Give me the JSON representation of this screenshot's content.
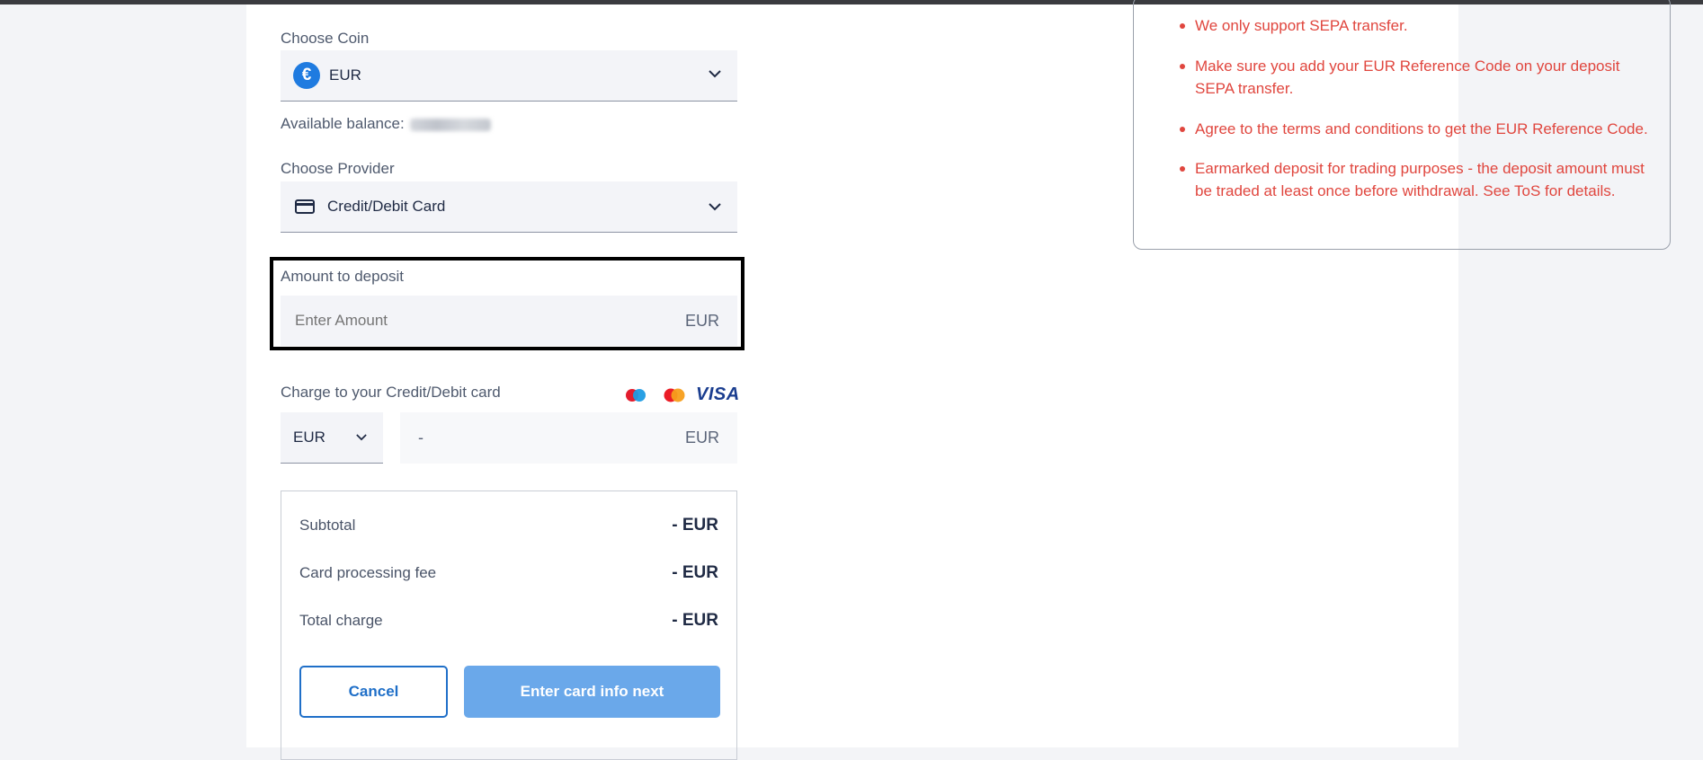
{
  "coin": {
    "label": "Choose Coin",
    "selected": "EUR",
    "icon_glyph": "€",
    "icon": "euro-coin-icon",
    "available_label": "Available balance:"
  },
  "provider": {
    "label": "Choose Provider",
    "selected": "Credit/Debit Card",
    "icon": "credit-card-icon"
  },
  "deposit": {
    "label": "Amount to deposit",
    "placeholder": "Enter Amount",
    "currency": "EUR"
  },
  "charge": {
    "label": "Charge to your Credit/Debit card",
    "currency_select": "EUR",
    "amount_value": "-",
    "amount_currency": "EUR",
    "card_brands": [
      "maestro-icon",
      "mastercard-icon",
      "VISA"
    ]
  },
  "summary": {
    "rows": [
      {
        "label": "Subtotal",
        "value": "- EUR"
      },
      {
        "label": "Card processing fee",
        "value": "- EUR"
      },
      {
        "label": "Total charge",
        "value": "- EUR"
      }
    ],
    "cancel_label": "Cancel",
    "next_label": "Enter card info next"
  },
  "notice": {
    "items": [
      "We only support SEPA transfer.",
      "Make sure you add your EUR Reference Code on your deposit SEPA transfer.",
      "Agree to the terms and conditions to get the EUR Reference Code.",
      "Earmarked deposit for trading purposes - the deposit amount must be traded at least once before withdrawal. See ToS for details."
    ]
  },
  "colors": {
    "accent": "#1f6fc8",
    "button_disabled": "#6aa8ea",
    "warning_text": "#e0463e",
    "field_bg": "#f3f4f8"
  }
}
